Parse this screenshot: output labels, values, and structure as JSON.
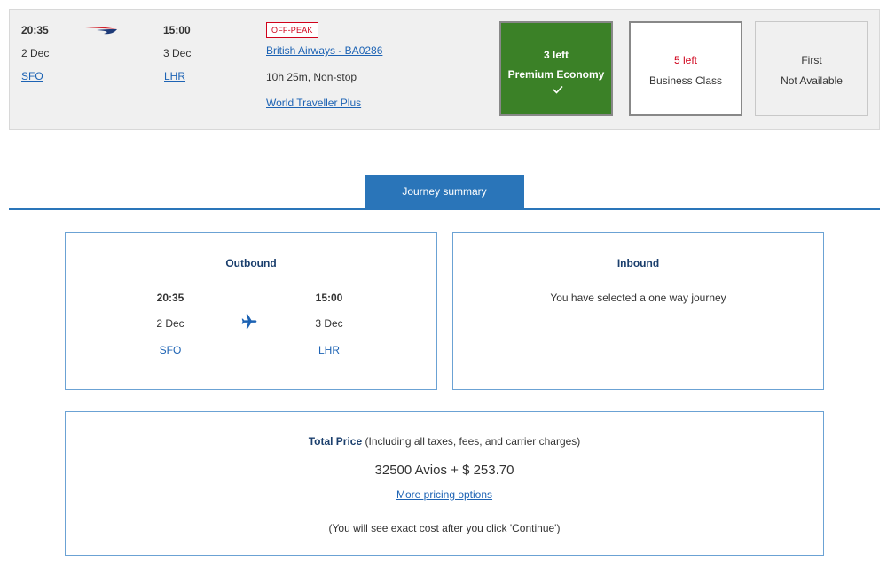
{
  "flight": {
    "depart_time": "20:35",
    "depart_date": "2 Dec",
    "depart_airport": "SFO",
    "arrive_time": "15:00",
    "arrive_date": "3 Dec",
    "arrive_airport": "LHR",
    "badge": "OFF-PEAK",
    "airline_flight": "British Airways - BA0286",
    "duration": "10h 25m, Non-stop",
    "fare_name": "World Traveller Plus",
    "logo_icon": "british-airways-speedmarque"
  },
  "cabins": {
    "premium_economy": {
      "availability": "3 left",
      "name": "Premium Economy",
      "selected_icon": "checkmark",
      "color": "#3b8127"
    },
    "business": {
      "availability": "5 left",
      "name": "Business Class",
      "availability_color": "#d0021b"
    },
    "first": {
      "name": "First",
      "availability": "Not Available"
    }
  },
  "summary_tab": {
    "label": "Journey summary",
    "color": "#2a75b9"
  },
  "outbound": {
    "title": "Outbound",
    "depart_time": "20:35",
    "depart_date": "2 Dec",
    "depart_airport": "SFO",
    "arrive_time": "15:00",
    "arrive_date": "3 Dec",
    "arrive_airport": "LHR",
    "icon": "plane-icon"
  },
  "inbound": {
    "title": "Inbound",
    "message": "You have selected a one way journey"
  },
  "price": {
    "title": "Total Price",
    "title_note": "(Including all taxes, fees, and carrier charges)",
    "amount": "32500 Avios + $ 253.70",
    "more_options": "More pricing options",
    "note": "(You will see exact cost after you click 'Continue')"
  }
}
